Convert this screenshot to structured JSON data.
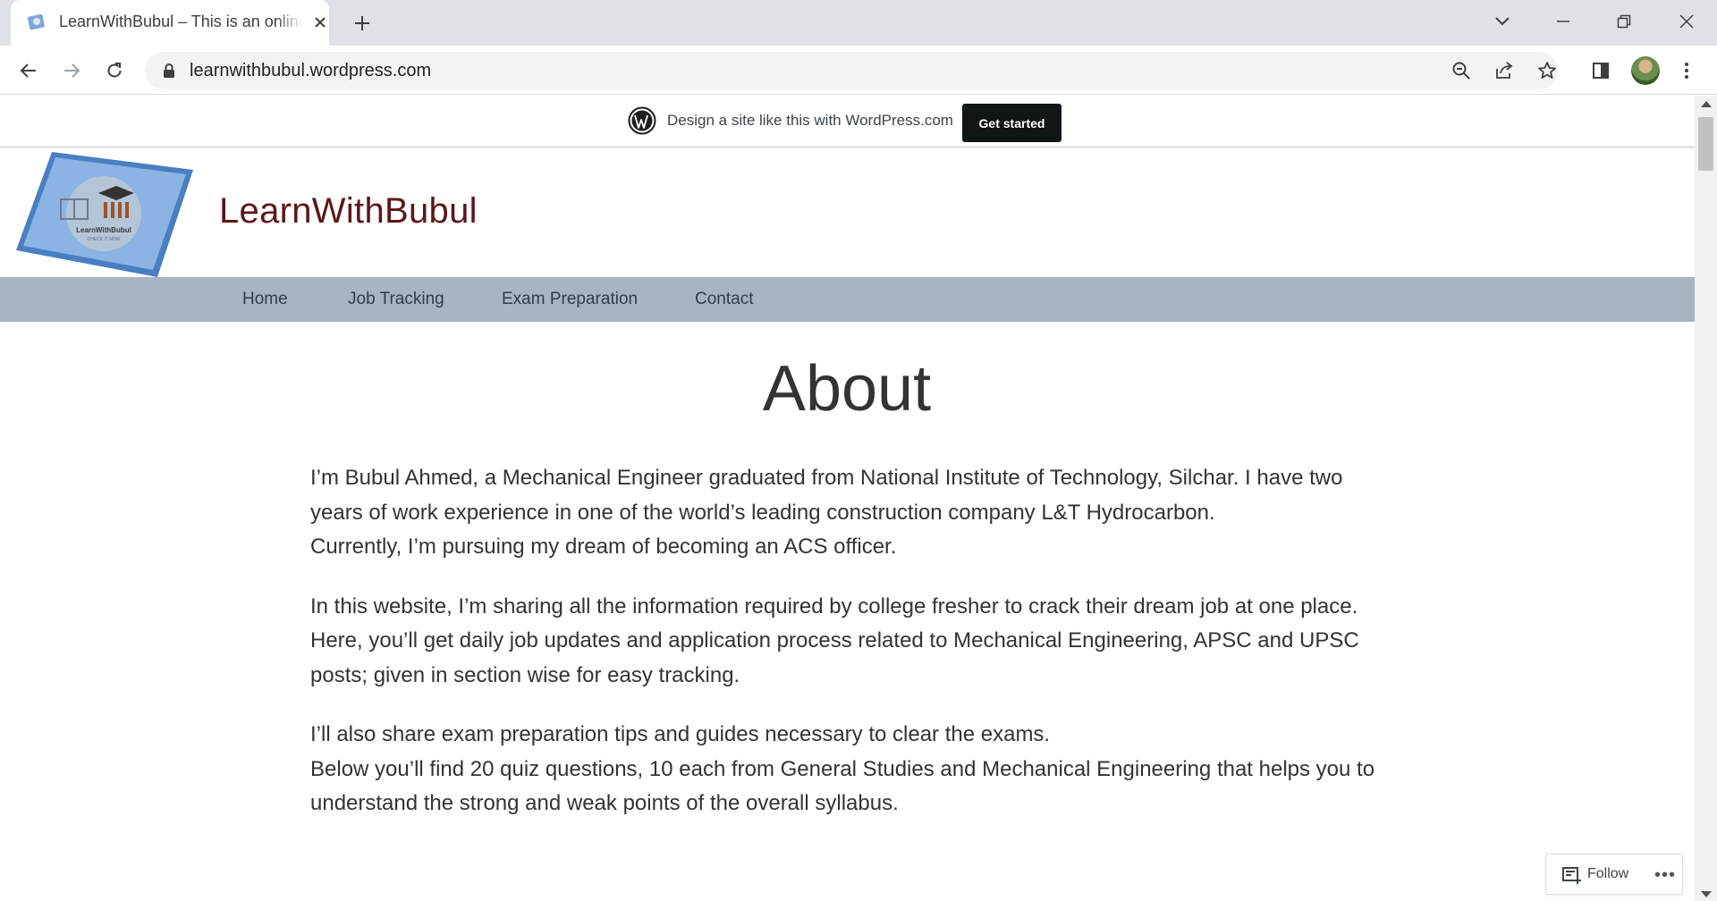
{
  "browser": {
    "tab_title": "LearnWithBubul – This is an online",
    "url": "learnwithbubul.wordpress.com"
  },
  "wp_banner": {
    "text": "Design a site like this with WordPress.com",
    "cta": "Get started"
  },
  "site": {
    "title": "LearnWithBubul",
    "logo_text": "LearnWithBubul",
    "logo_subtext": "CHECK IT NOW"
  },
  "nav": {
    "items": [
      {
        "label": "Home"
      },
      {
        "label": "Job Tracking"
      },
      {
        "label": "Exam Preparation"
      },
      {
        "label": "Contact"
      }
    ]
  },
  "page": {
    "title": "About",
    "paragraphs": [
      {
        "lines": [
          "I’m Bubul Ahmed, a Mechanical Engineer graduated from National Institute of Technology, Silchar. I have two years of work experience in one of the world’s leading construction company L&T Hydrocarbon.",
          "Currently, I’m pursuing my dream of becoming an ACS officer."
        ]
      },
      {
        "lines": [
          "In this website, I’m sharing all the information required by college fresher to crack their dream job at one place. Here, you’ll get daily job updates and application process related to Mechanical Engineering, APSC and UPSC posts; given in section wise for easy tracking."
        ]
      },
      {
        "lines": [
          "I’ll also share exam preparation tips and guides necessary to clear the exams.",
          "Below you’ll find 20 quiz questions, 10 each from General Studies and Mechanical Engineering that helps you to understand the strong and weak points of the overall syllabus."
        ]
      }
    ]
  },
  "follow_widget": {
    "label": "Follow",
    "more": "•••"
  },
  "colors": {
    "nav_bg": "#a7b4c1",
    "site_title": "#5c1717",
    "cta_bg": "#101517"
  }
}
